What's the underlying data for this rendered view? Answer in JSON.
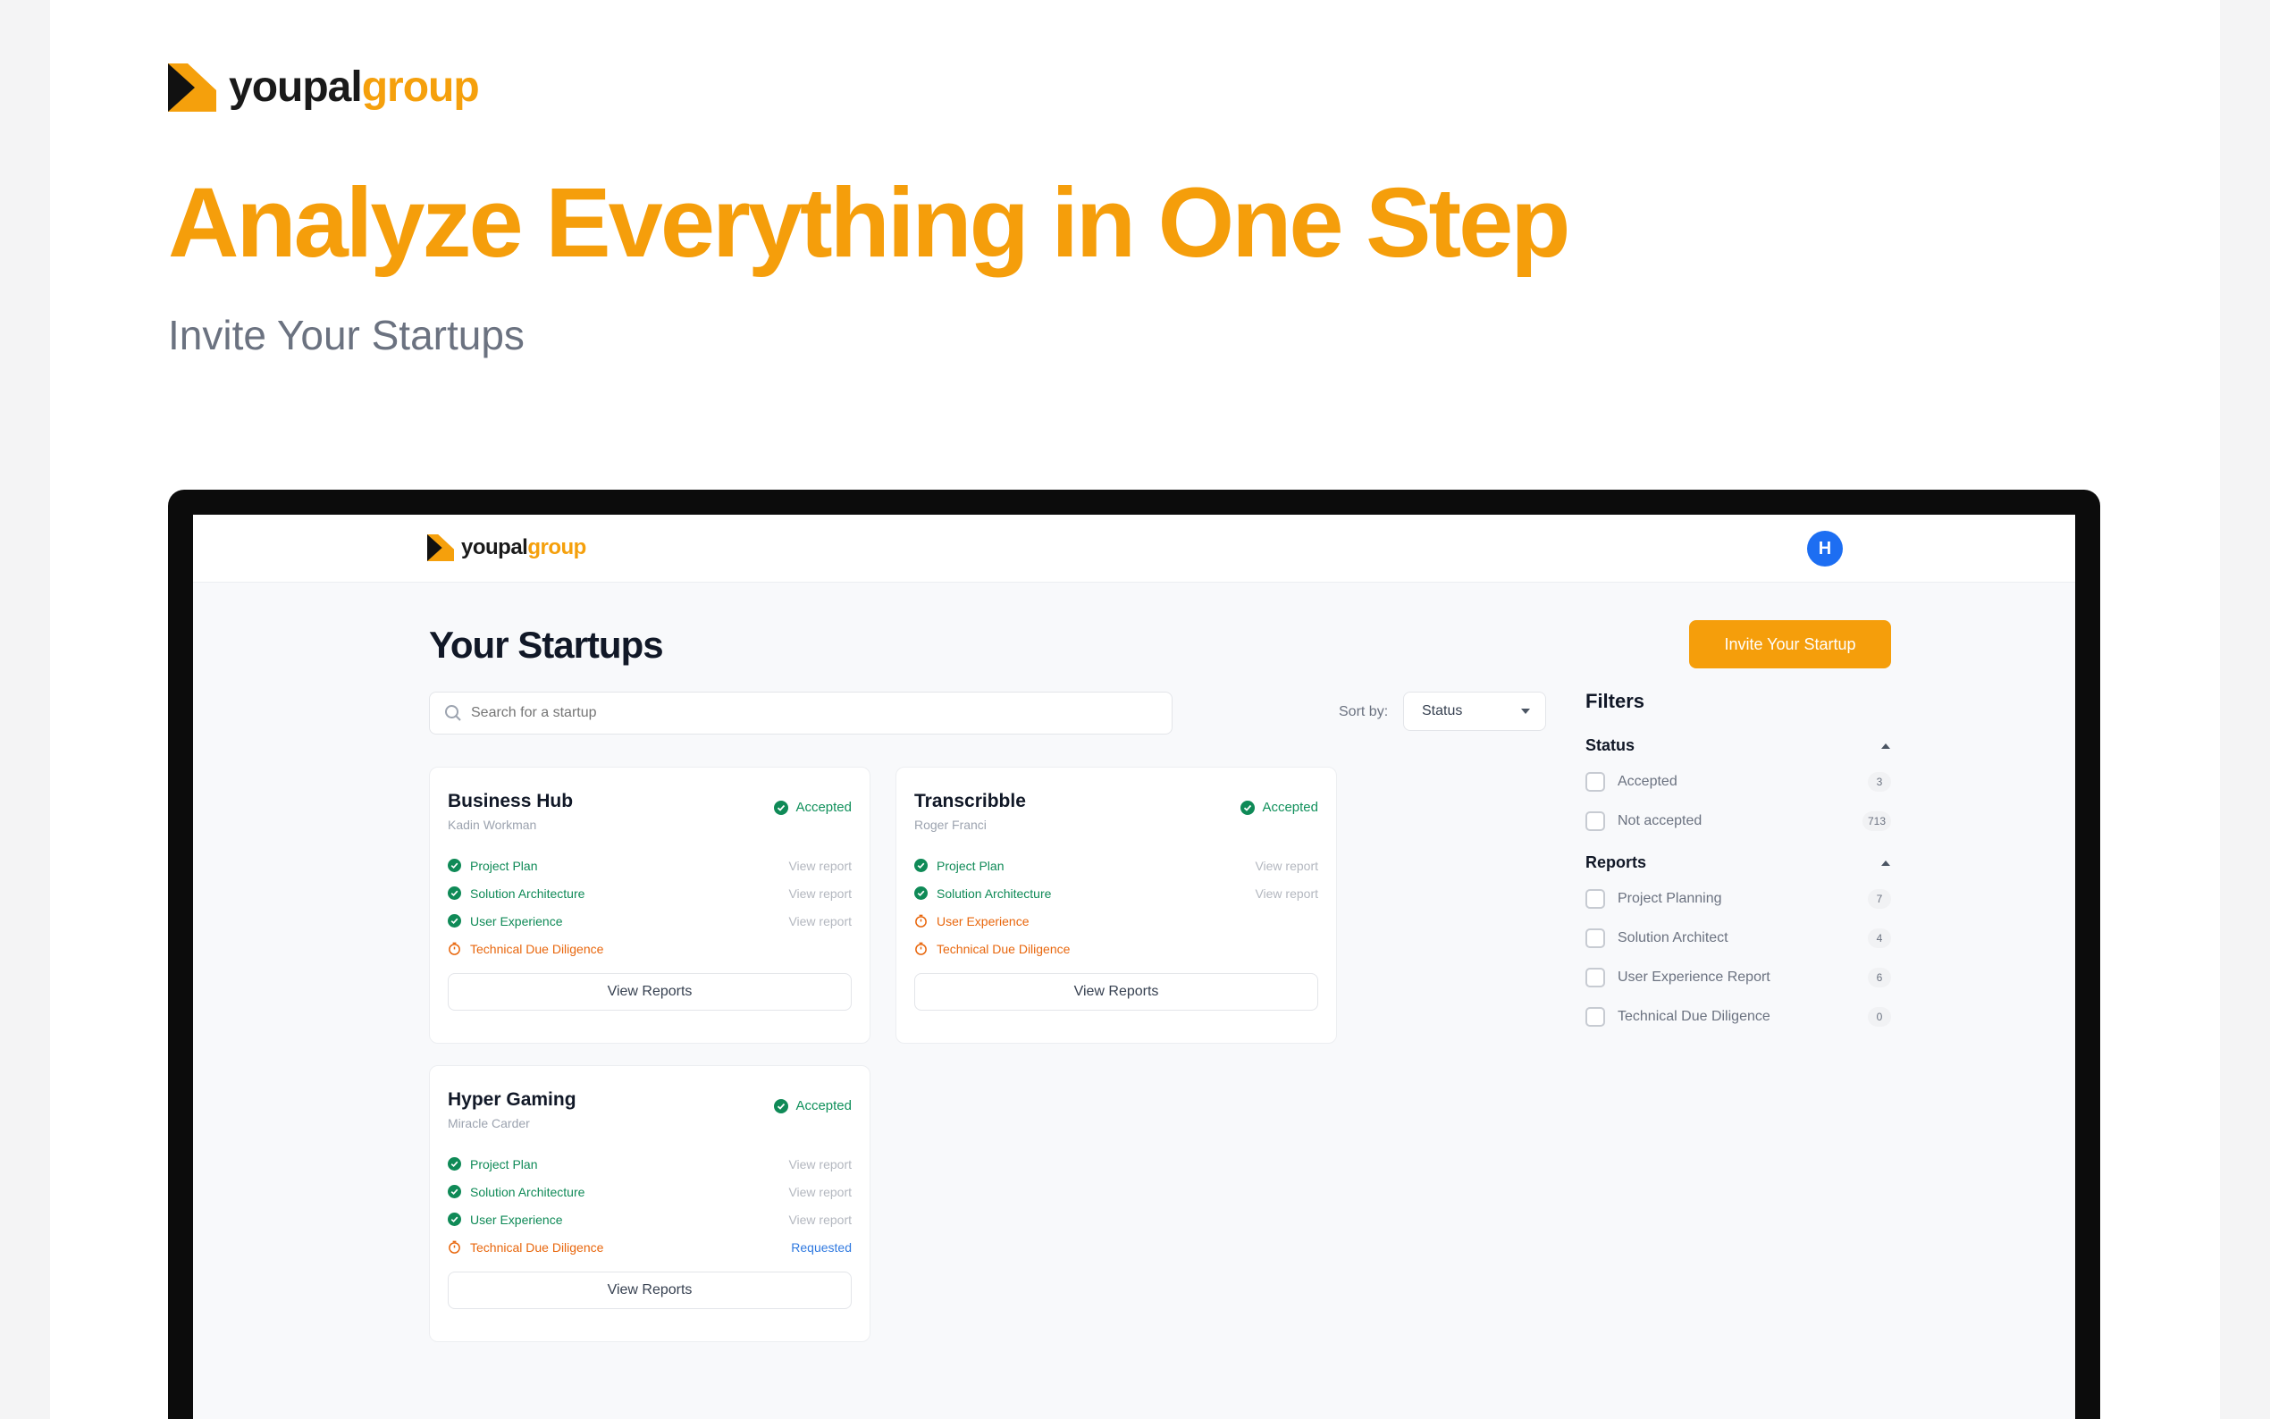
{
  "brand": {
    "part1": "youpal",
    "part2": "group"
  },
  "hero": {
    "title": "Analyze Everything in One Step",
    "subtitle": "Invite Your Startups"
  },
  "app": {
    "brand": {
      "part1": "youpal",
      "part2": "group"
    },
    "avatar_initial": "H",
    "page_title": "Your Startups",
    "invite_label": "Invite Your Startup",
    "search_placeholder": "Search for a startup",
    "sort_label": "Sort by:",
    "sort_value": "Status",
    "cards": [
      {
        "name": "Business Hub",
        "owner": "Kadin Workman",
        "status": "Accepted",
        "rows": [
          {
            "label": "Project Plan",
            "action": "View report"
          },
          {
            "label": "Solution Architecture",
            "action": "View report"
          },
          {
            "label": "User Experience",
            "action": "View report"
          },
          {
            "label": "Technical Due Diligence",
            "action": ""
          }
        ],
        "button": "View Reports"
      },
      {
        "name": "Transcribble",
        "owner": "Roger Franci",
        "status": "Accepted",
        "rows": [
          {
            "label": "Project Plan",
            "action": "View report"
          },
          {
            "label": "Solution Architecture",
            "action": "View report"
          },
          {
            "label": "User Experience",
            "action": ""
          },
          {
            "label": "Technical Due Diligence",
            "action": ""
          }
        ],
        "button": "View Reports"
      },
      {
        "name": "Hyper Gaming",
        "owner": "Miracle Carder",
        "status": "Accepted",
        "rows": [
          {
            "label": "Project Plan",
            "action": "View report"
          },
          {
            "label": "Solution Architecture",
            "action": "View report"
          },
          {
            "label": "User Experience",
            "action": "View report"
          },
          {
            "label": "Technical Due Diligence",
            "action": "Requested"
          }
        ],
        "button": "View Reports"
      }
    ],
    "filters": {
      "title": "Filters",
      "status": {
        "title": "Status",
        "items": [
          {
            "label": "Accepted",
            "count": "3"
          },
          {
            "label": "Not accepted",
            "count": "713"
          }
        ]
      },
      "reports": {
        "title": "Reports",
        "items": [
          {
            "label": "Project Planning",
            "count": "7"
          },
          {
            "label": "Solution Architect",
            "count": "4"
          },
          {
            "label": "User Experience Report",
            "count": "6"
          },
          {
            "label": "Technical Due Diligence",
            "count": "0"
          }
        ]
      }
    }
  },
  "colors": {
    "accent": "#f59e0b",
    "success": "#0f8a57",
    "pending": "#e8660c",
    "link": "#2f79e0",
    "avatar": "#1d6ef2"
  }
}
